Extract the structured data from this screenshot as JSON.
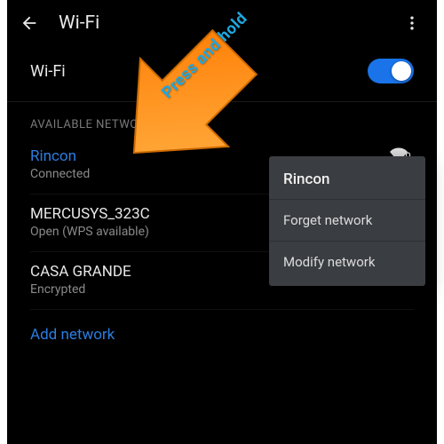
{
  "colors": {
    "accent": "#1a73e8",
    "linkBlue": "#2b7de1",
    "arrowOrange": "#ff8c00",
    "overlayBg": "#3a3d41"
  },
  "header": {
    "title": "Wi-Fi"
  },
  "toggle": {
    "label": "Wi-Fi",
    "on": true
  },
  "section": {
    "title": "AVAILABLE NETWORKS"
  },
  "networks": [
    {
      "name": "Rincon",
      "sub": "Connected",
      "current": true
    },
    {
      "name": "MERCUSYS_323C",
      "sub": "Open (WPS available)",
      "current": false
    },
    {
      "name": "CASA GRANDE",
      "sub": "Encrypted",
      "current": false
    }
  ],
  "addNetwork": "Add network",
  "contextMenu": {
    "title": "Rincon",
    "items": [
      "Forget network",
      "Modify network"
    ]
  },
  "annotation": {
    "text": "Press and hold"
  }
}
